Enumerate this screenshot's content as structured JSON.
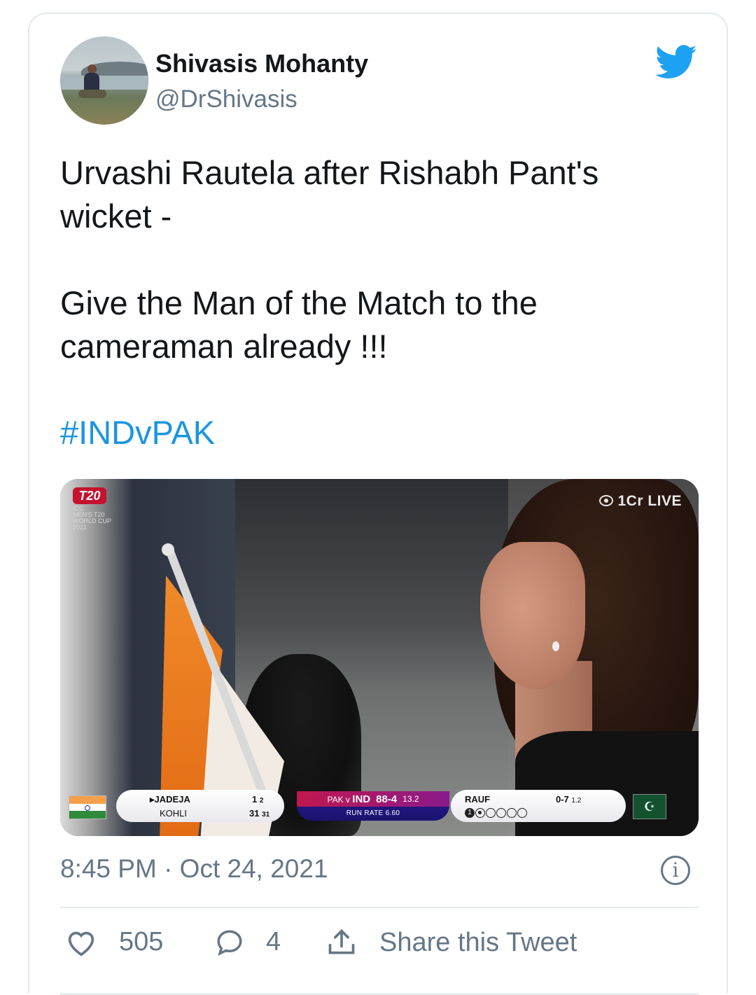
{
  "author": {
    "name": "Shivasis Mohanty",
    "handle": "@DrShivasis"
  },
  "tweet": {
    "text": "Urvashi Rautela after Rishabh Pant's\nwicket -\n\nGive the Man of the Match to the\ncameraman already !!!",
    "hashtag": "#INDvPAK"
  },
  "media": {
    "logo_badge": "T20",
    "logo_sub": "ICC\nMEN'S T20\nWORLD CUP\n2021",
    "live_label": "1Cr LIVE",
    "scoreboard": {
      "batter1": "JADEJA",
      "batter1_score": "1",
      "batter1_balls": "2",
      "batter2": "KOHLI",
      "batter2_score": "31",
      "batter2_balls": "31",
      "match": "PAK v",
      "team": "IND",
      "score": "88-4",
      "overs": "13.2",
      "run_rate": "RUN RATE 6.60",
      "bowler": "RAUF",
      "bowler_figures": "0-7",
      "bowler_overs": "1.2",
      "first_ball": "1"
    }
  },
  "meta": {
    "timestamp": "8:45 PM · Oct 24, 2021"
  },
  "actions": {
    "likes": "505",
    "replies": "4",
    "share_label": "Share this Tweet"
  },
  "colors": {
    "twitter_blue": "#1da1f2",
    "hashtag": "#1b95e0",
    "secondary_text": "#657786"
  }
}
